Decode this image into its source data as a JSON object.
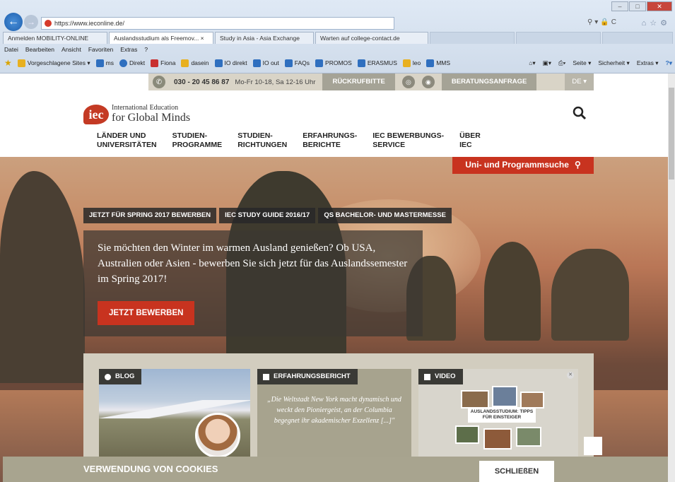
{
  "browser": {
    "url": "https://www.ieconline.de/",
    "tabs": [
      {
        "label": "Anmelden MOBILITY-ONLINE"
      },
      {
        "label": "Auslandsstudium als Freemov... ×"
      },
      {
        "label": "Study in Asia - Asia Exchange"
      },
      {
        "label": "Warten auf college-contact.de"
      }
    ],
    "menu": [
      "Datei",
      "Bearbeiten",
      "Ansicht",
      "Favoriten",
      "Extras",
      "?"
    ],
    "favorites": [
      {
        "label": "Vorgeschlagene Sites ▾",
        "color": "#e8b020"
      },
      {
        "label": "ms",
        "color": "#2f6fbf"
      },
      {
        "label": "Direkt",
        "color": "#2f6fbf"
      },
      {
        "label": "Fiona",
        "color": "#c83030"
      },
      {
        "label": "dasein",
        "color": "#e8b020"
      },
      {
        "label": "IO direkt",
        "color": "#2f6fbf"
      },
      {
        "label": "IO out",
        "color": "#2f6fbf"
      },
      {
        "label": "FAQs",
        "color": "#2f6fbf"
      },
      {
        "label": "PROMOS",
        "color": "#2f6fbf"
      },
      {
        "label": "ERASMUS",
        "color": "#2f6fbf"
      },
      {
        "label": "leo",
        "color": "#e8b020"
      },
      {
        "label": "MMS",
        "color": "#2f6fbf"
      }
    ],
    "command_bar": [
      "Seite ▾",
      "Sicherheit ▾",
      "Extras ▾"
    ]
  },
  "site": {
    "topbar": {
      "phone": "030 - 20 45 86 87",
      "hours": "Mo-Fr 10-18, Sa 12-16 Uhr",
      "callback": "RÜCKRUFBITTE",
      "consult": "BERATUNGSANFRAGE",
      "lang": "DE ▾"
    },
    "logo": {
      "mark": "iec",
      "line1": "International Education",
      "line2": "for Global Minds"
    },
    "nav": [
      "LÄNDER UND\nUNIVERSITÄTEN",
      "STUDIEN-\nPROGRAMME",
      "STUDIEN-\nRICHTUNGEN",
      "ERFAHRUNGS-\nBERICHTE",
      "IEC BEWERBUNGS-\nSERVICE",
      "ÜBER\nIEC"
    ],
    "finder_button": "Uni- und Programmsuche",
    "hero_tabs": [
      "JETZT FÜR SPRING 2017 BEWERBEN",
      "IEC STUDY GUIDE 2016/17",
      "QS BACHELOR- UND MASTERMESSE"
    ],
    "hero_text": "Sie möchten den Winter im warmen Ausland genießen? Ob USA, Australien oder Asien - bewerben Sie sich jetzt für das Auslandssemester im Spring 2017!",
    "hero_cta": "JETZT BEWERBEN",
    "cards": {
      "blog": "BLOG",
      "report": "ERFAHRUNGSBERICHT",
      "quote": "„Die Weltstadt New York macht dynamisch und weckt den Pioniergeist, an der Columbia begegnet ihr akademischer Exzellenz [...]\"",
      "video": "VIDEO",
      "video_caption": "AUSLANDSSTUDIUM: TIPPS FÜR EINSTEIGER"
    },
    "cookie": {
      "title": "VERWENDUNG VON COOKIES",
      "button": "SCHLIEßEN"
    }
  },
  "colors": {
    "brand_red": "#c8331f",
    "panel_beige": "#d2cdbf",
    "cookie_bg": "#a8a48f"
  }
}
